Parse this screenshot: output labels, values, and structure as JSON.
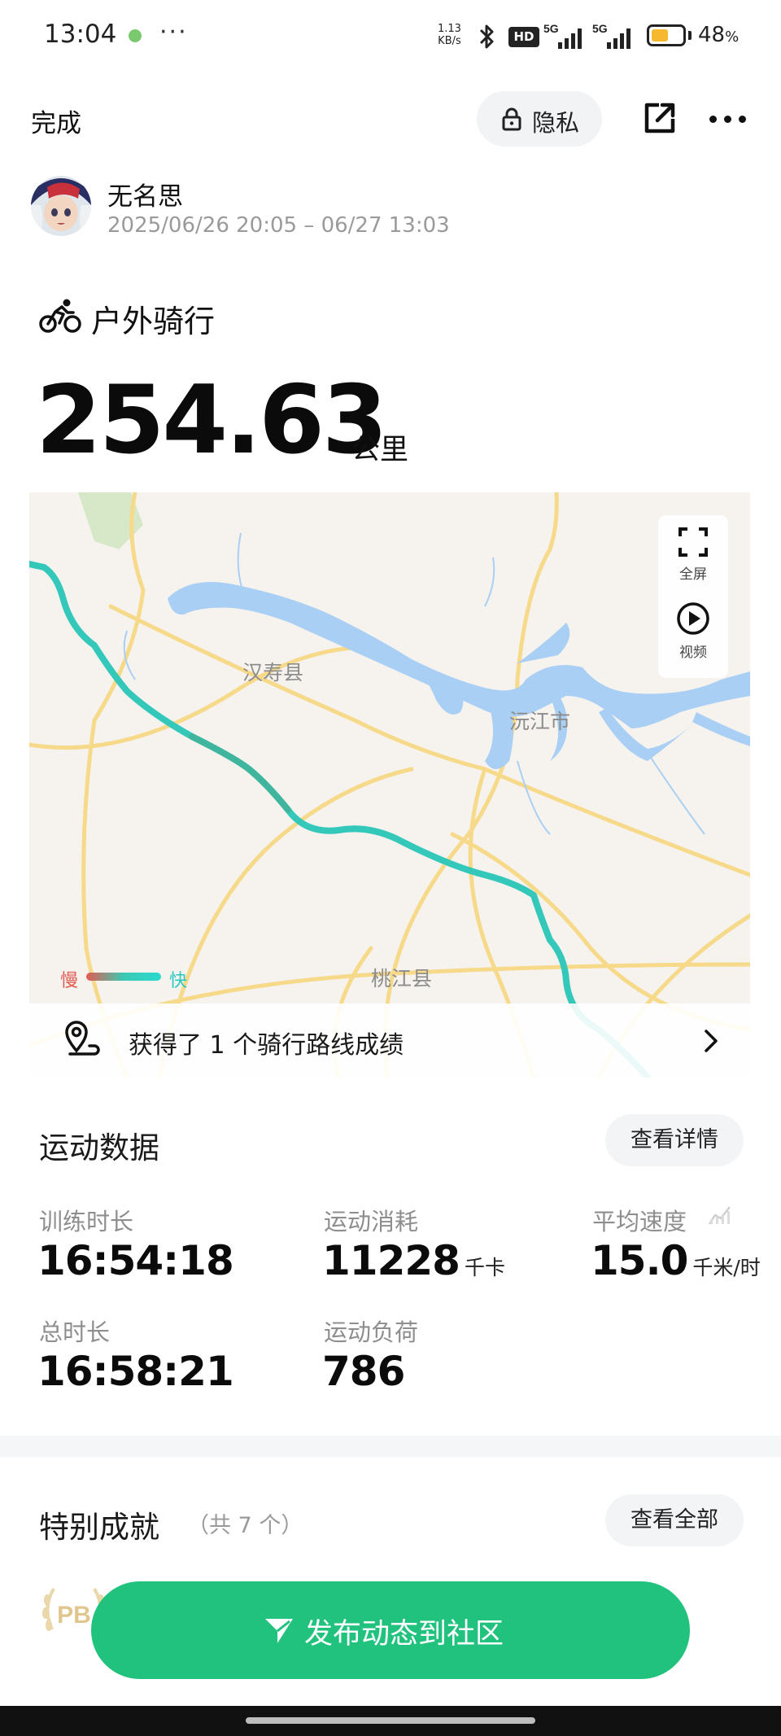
{
  "status_bar": {
    "time": "13:04",
    "more": "···",
    "net_speed_value": "1.13",
    "net_speed_unit": "KB/s",
    "hd_badge": "HD",
    "signal_1": "5G",
    "signal_2": "5G",
    "battery_percent": "48",
    "battery_percent_sign": "%",
    "battery_level": 0.48
  },
  "header": {
    "done_label": "完成",
    "privacy_label": "隐私"
  },
  "user": {
    "name": "无名思",
    "time_range": "2025/06/26 20:05 – 06/27 13:03"
  },
  "activity": {
    "type_label": "户外骑行",
    "distance": "254.63",
    "distance_unit": "公里"
  },
  "map": {
    "labels": {
      "hanshou": "汉寿县",
      "yuanjiang": "沅江市",
      "taojiang": "桃江县"
    },
    "fullscreen_label": "全屏",
    "video_label": "视频",
    "legend_slow": "慢",
    "legend_fast": "快",
    "route_achievement_text": "获得了 1 个骑行路线成绩",
    "colors": {
      "water": "#a9cff4",
      "road": "#f7d98a",
      "route": "#34c8bb",
      "park": "#d6e8c8"
    }
  },
  "workout_data": {
    "title": "运动数据",
    "details_button": "查看详情",
    "stats": [
      {
        "label": "训练时长",
        "value": "16:54:18",
        "unit": ""
      },
      {
        "label": "运动消耗",
        "value": "11228",
        "unit": "千卡"
      },
      {
        "label": "平均速度",
        "value": "15.0",
        "unit": "千米/时"
      },
      {
        "label": "总时长",
        "value": "16:58:21",
        "unit": ""
      },
      {
        "label": "运动负荷",
        "value": "786",
        "unit": ""
      }
    ]
  },
  "achievements": {
    "title": "特别成就",
    "count_note": "（共 7 个）",
    "view_all_button": "查看全部",
    "badge_text": "PB"
  },
  "publish_button": {
    "label": "发布动态到社区",
    "color": "#21c27d"
  }
}
